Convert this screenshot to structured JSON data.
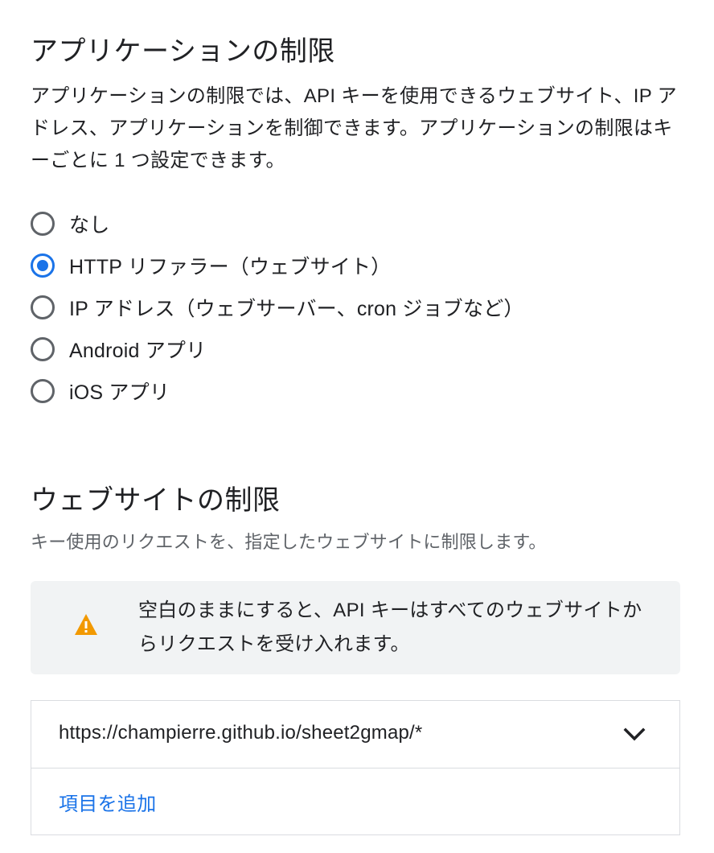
{
  "app_restrictions": {
    "title": "アプリケーションの制限",
    "description": "アプリケーションの制限では、API キーを使用できるウェブサイト、IP アドレス、アプリケーションを制御できます。アプリケーションの制限はキーごとに 1 つ設定できます。",
    "options": [
      {
        "label": "なし",
        "selected": false
      },
      {
        "label": "HTTP リファラー（ウェブサイト）",
        "selected": true
      },
      {
        "label": "IP アドレス（ウェブサーバー、cron ジョブなど）",
        "selected": false
      },
      {
        "label": "Android アプリ",
        "selected": false
      },
      {
        "label": "iOS アプリ",
        "selected": false
      }
    ]
  },
  "website_restrictions": {
    "title": "ウェブサイトの制限",
    "subtitle": "キー使用のリクエストを、指定したウェブサイトに制限します。",
    "warning": {
      "icon": "warning-icon",
      "text": "空白のままにすると、API キーはすべてのウェブサイトからリクエストを受け入れます。"
    },
    "items": [
      {
        "value": "https://champierre.github.io/sheet2gmap/*",
        "icon": "chevron-down-icon"
      }
    ],
    "add_item_label": "項目を追加"
  },
  "colors": {
    "accent": "#1a73e8",
    "warning": "#f29900",
    "panel_bg": "#f1f3f4"
  }
}
